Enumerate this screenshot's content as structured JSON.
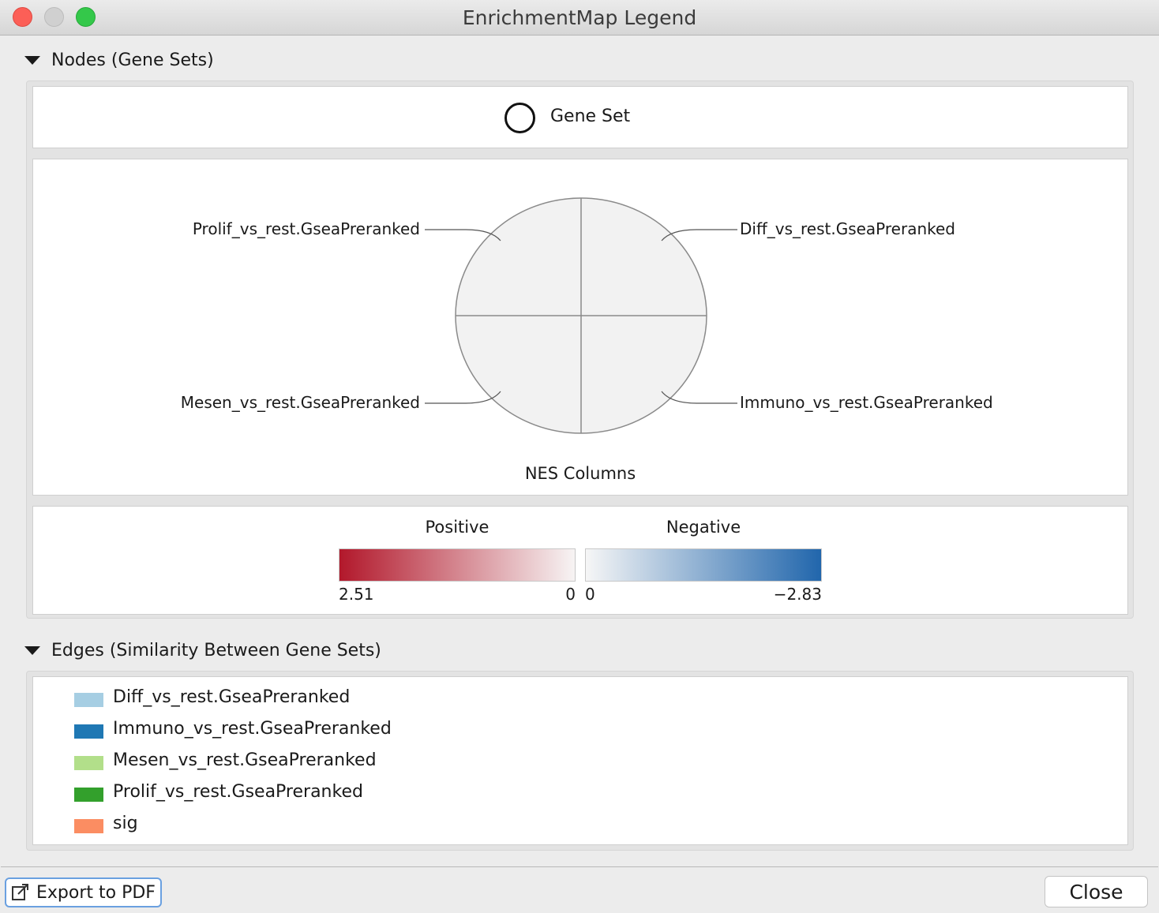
{
  "window": {
    "title": "EnrichmentMap Legend"
  },
  "nodes_section": {
    "header": "Nodes (Gene Sets)",
    "gene_set_label": "Gene Set",
    "chart": {
      "top_left": "Prolif_vs_rest.GseaPreranked",
      "top_right": "Diff_vs_rest.GseaPreranked",
      "bottom_left": "Mesen_vs_rest.GseaPreranked",
      "bottom_right": "Immuno_vs_rest.GseaPreranked",
      "caption": "NES Columns"
    },
    "colors": {
      "positive_label": "Positive",
      "negative_label": "Negative",
      "positive_max": "2.51",
      "positive_min": "0",
      "negative_min": "0",
      "negative_max": "−2.83",
      "positive_color": "#b2182b",
      "negative_color": "#2166ac"
    }
  },
  "edges_section": {
    "header": "Edges (Similarity Between Gene Sets)",
    "items": [
      {
        "label": "Diff_vs_rest.GseaPreranked",
        "color": "#a6cee3"
      },
      {
        "label": "Immuno_vs_rest.GseaPreranked",
        "color": "#1f78b4"
      },
      {
        "label": "Mesen_vs_rest.GseaPreranked",
        "color": "#b2df8a"
      },
      {
        "label": "Prolif_vs_rest.GseaPreranked",
        "color": "#33a02c"
      },
      {
        "label": "sig",
        "color": "#fb8d62"
      }
    ]
  },
  "buttons": {
    "export": "Export to PDF",
    "close": "Close"
  }
}
